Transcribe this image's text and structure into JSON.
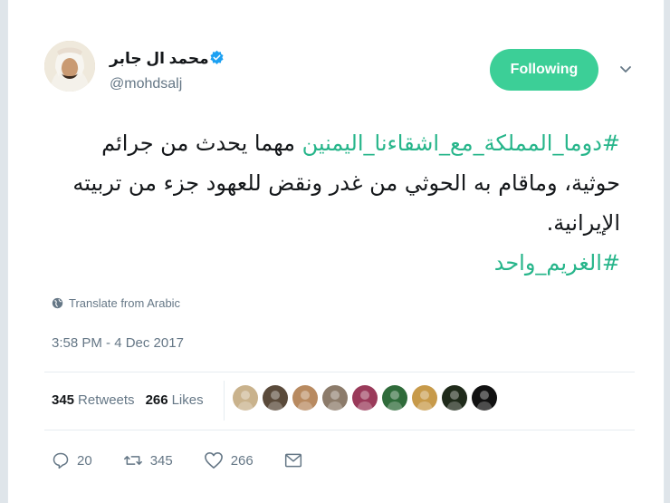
{
  "author": {
    "name": "محمد ال جابر",
    "handle": "@mohdsalj",
    "verified": true
  },
  "follow_button": {
    "label": "Following"
  },
  "tweet": {
    "hashtag_top": "#دوما_المملكة_مع_اشقاءنا_اليمنين",
    "text_rest": " مهما يحدث من جرائم حوثية، وماقام به الحوثي من غدر ونقض للعهود جزء من تربيته الإيرانية.",
    "hashtag_bottom": "#الغريم_واحد"
  },
  "translate": {
    "label": "Translate from Arabic",
    "icon": "globe-icon"
  },
  "timestamp": "3:58 PM - 4 Dec 2017",
  "stats": {
    "retweets_count": "345",
    "retweets_label": "Retweets",
    "likes_count": "266",
    "likes_label": "Likes"
  },
  "likers": [
    {
      "color": "#c9b28c"
    },
    {
      "color": "#5a4a3a"
    },
    {
      "color": "#b88a60"
    },
    {
      "color": "#8c7b6a"
    },
    {
      "color": "#9a3a5a"
    },
    {
      "color": "#2f6b3a"
    },
    {
      "color": "#c79a4a"
    },
    {
      "color": "#1f2a1a"
    },
    {
      "color": "#111111"
    }
  ],
  "actions": {
    "reply_count": "20",
    "retweet_count": "345",
    "like_count": "266"
  },
  "colors": {
    "accent": "#3ccf97",
    "hashtag": "#26b58a",
    "muted": "#657786",
    "verified": "#1da1f2"
  }
}
